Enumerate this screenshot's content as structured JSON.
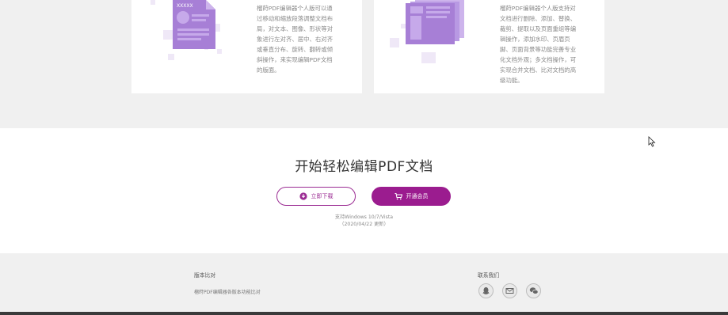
{
  "features": {
    "left_card": {
      "illustration_label": "XXXXX",
      "text": "榴莳PDF编辑器个人版可以通\n过移动和缩放段落调整文档布\n局，对文本、图像、形状等对\n象进行左对齐、居中、右对齐\n或垂直分布、旋转、翻转或倾\n斜操作，来实现编辑PDF文档\n的版面。"
    },
    "right_card": {
      "text": "榴莳PDF编辑器个人版支持对\n文档进行删除、添加、替换、\n裁剪、提取以及页面重组等编\n辑操作，添加水印、页眉页\n脚、页面背景等功能完善专业\n化文档外观；多文档操作，可\n实现合并文档、比对文档的高\n级功能。"
    }
  },
  "cta": {
    "title": "开始轻松编辑PDF文档",
    "download_label": "立即下载",
    "member_label": "开通会员",
    "support_line1": "支持Windows 10/7/Vista",
    "support_line2": "（2020/04/22 更新）"
  },
  "footer": {
    "compare_heading": "版本比对",
    "compare_link": "榴莳PDF编辑器各版本功能比对",
    "contact_heading": "联系我们",
    "social": [
      "qq-icon",
      "mail-icon",
      "wechat-icon"
    ]
  },
  "colors": {
    "accent": "#9b1c8f",
    "illustration": "#a77fd6",
    "page_bg": "#f0f0f0"
  }
}
